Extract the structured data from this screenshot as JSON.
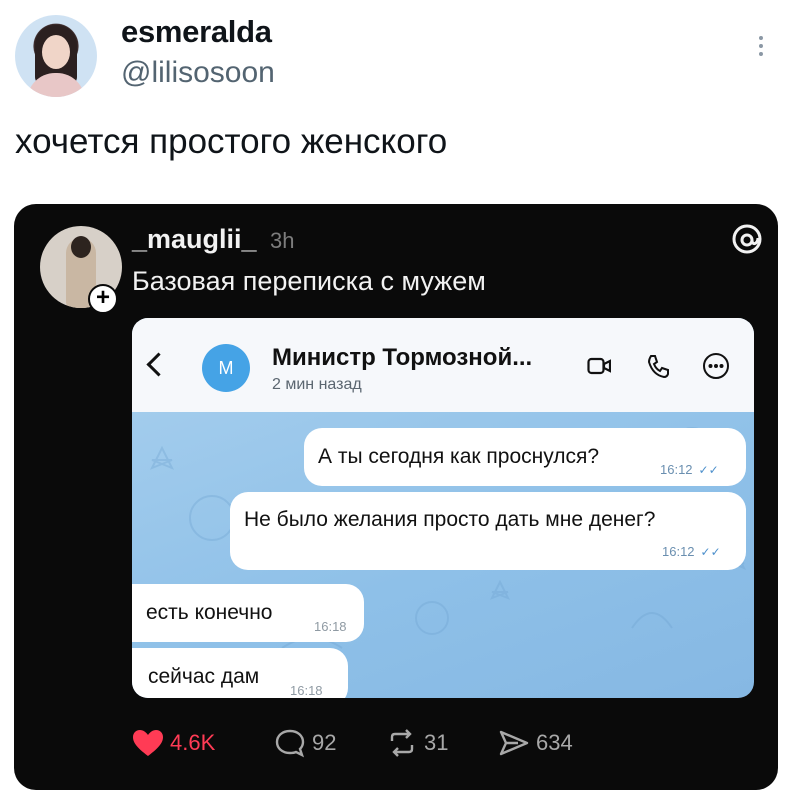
{
  "tweet": {
    "display_name": "esmeralda",
    "handle": "@lilisosoon",
    "text": "хочется простого женского"
  },
  "embed": {
    "username": "_mauglii_",
    "time": "3h",
    "text": "Базовая переписка с мужем",
    "chat": {
      "contact_name": "Министр Тормозной...",
      "avatar_letter": "M",
      "status": "2 мин назад",
      "messages": [
        {
          "text": "А ты сегодня как проснулся?",
          "time": "16:12",
          "outgoing": true
        },
        {
          "text": "Не было желания просто дать мне денег?",
          "time": "16:12",
          "outgoing": true
        },
        {
          "text": "есть конечно",
          "time": "16:18",
          "outgoing": false
        },
        {
          "text": "сейчас дам",
          "time": "16:18",
          "outgoing": false
        }
      ]
    },
    "actions": {
      "likes": "4.6K",
      "replies": "92",
      "reposts": "31",
      "shares": "634"
    }
  },
  "colors": {
    "like": "#ff3b55",
    "card_bg": "#0a0a0a",
    "chat_bg": "#9cc8ec",
    "tg_accent": "#45a3e6"
  },
  "icons": [
    "more-vertical-icon",
    "threads-logo-icon",
    "back-chevron-icon",
    "video-camera-icon",
    "phone-icon",
    "more-options-icon",
    "heart-icon",
    "comment-icon",
    "repost-icon",
    "share-icon",
    "plus-icon"
  ]
}
